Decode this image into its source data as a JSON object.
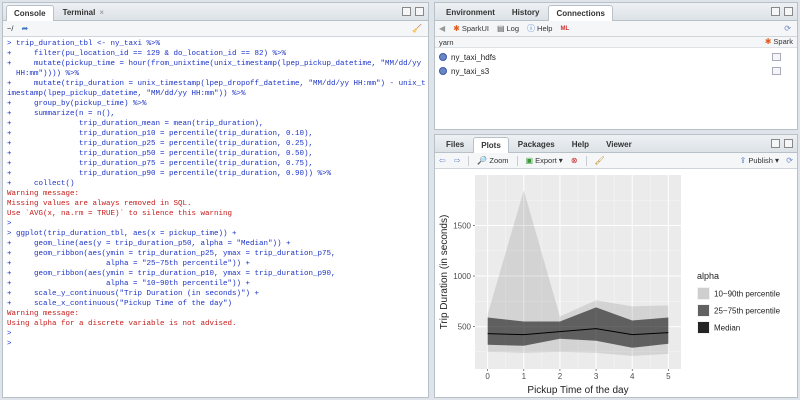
{
  "left_pane": {
    "tabs": [
      {
        "label": "Console",
        "active": true
      },
      {
        "label": "Terminal",
        "active": false
      }
    ],
    "path": "~/",
    "console_lines": [
      {
        "type": "in",
        "text": "> trip_duration_tbl <- ny_taxi %>%"
      },
      {
        "type": "in",
        "text": "+     filter(pu_location_id == 129 & do_location_id == 82) %>%"
      },
      {
        "type": "in",
        "text": "+     mutate(pickup_time = hour(from_unixtime(unix_timestamp(lpep_pickup_datetime, \"MM/dd/yy"
      },
      {
        "type": "in",
        "text": "  HH:mm\")))) %>%"
      },
      {
        "type": "in",
        "text": "+     mutate(trip_duration = unix_timestamp(lpep_dropoff_datetime, \"MM/dd/yy HH:mm\") - unix_t"
      },
      {
        "type": "in",
        "text": "imestamp(lpep_pickup_datetime, \"MM/dd/yy HH:mm\")) %>%"
      },
      {
        "type": "in",
        "text": "+     group_by(pickup_time) %>%"
      },
      {
        "type": "in",
        "text": "+     summarize(n = n(),"
      },
      {
        "type": "in",
        "text": "+               trip_duration_mean = mean(trip_duration),"
      },
      {
        "type": "in",
        "text": "+               trip_duration_p10 = percentile(trip_duration, 0.10),"
      },
      {
        "type": "in",
        "text": "+               trip_duration_p25 = percentile(trip_duration, 0.25),"
      },
      {
        "type": "in",
        "text": "+               trip_duration_p50 = percentile(trip_duration, 0.50),"
      },
      {
        "type": "in",
        "text": "+               trip_duration_p75 = percentile(trip_duration, 0.75),"
      },
      {
        "type": "in",
        "text": "+               trip_duration_p90 = percentile(trip_duration, 0.90)) %>%"
      },
      {
        "type": "in",
        "text": "+     collect()"
      },
      {
        "type": "err",
        "text": "Warning message:"
      },
      {
        "type": "err",
        "text": "Missing values are always removed in SQL."
      },
      {
        "type": "err",
        "text": "Use `AVG(x, na.rm = TRUE)` to silence this warning"
      },
      {
        "type": "in",
        "text": ">"
      },
      {
        "type": "in",
        "text": "> ggplot(trip_duration_tbl, aes(x = pickup_time)) +"
      },
      {
        "type": "in",
        "text": "+     geom_line(aes(y = trip_duration_p50, alpha = \"Median\")) +"
      },
      {
        "type": "in",
        "text": "+     geom_ribbon(aes(ymin = trip_duration_p25, ymax = trip_duration_p75,"
      },
      {
        "type": "in",
        "text": "+                     alpha = \"25~75th percentile\")) +"
      },
      {
        "type": "in",
        "text": "+     geom_ribbon(aes(ymin = trip_duration_p10, ymax = trip_duration_p90,"
      },
      {
        "type": "in",
        "text": "+                     alpha = \"10~90th percentile\")) +"
      },
      {
        "type": "in",
        "text": "+     scale_y_continuous(\"Trip Duration (in seconds)\") +"
      },
      {
        "type": "in",
        "text": "+     scale_x_continuous(\"Pickup Time of the day\")"
      },
      {
        "type": "err",
        "text": "Warning message:"
      },
      {
        "type": "err",
        "text": "Using alpha for a discrete variable is not advised."
      },
      {
        "type": "in",
        "text": ">"
      },
      {
        "type": "in",
        "text": ">"
      }
    ]
  },
  "top_right": {
    "tabs": [
      {
        "label": "Environment",
        "active": false
      },
      {
        "label": "History",
        "active": false
      },
      {
        "label": "Connections",
        "active": true
      }
    ],
    "toolbar": {
      "sparkui": "SparkUI",
      "log": "Log",
      "help": "Help"
    },
    "connection_type": "yarn",
    "spark_label": "Spark",
    "connections": [
      "ny_taxi_hdfs",
      "ny_taxi_s3"
    ]
  },
  "bottom_right": {
    "tabs": [
      {
        "label": "Files",
        "active": false
      },
      {
        "label": "Plots",
        "active": true
      },
      {
        "label": "Packages",
        "active": false
      },
      {
        "label": "Help",
        "active": false
      },
      {
        "label": "Viewer",
        "active": false
      }
    ],
    "toolbar": {
      "zoom": "Zoom",
      "export": "Export",
      "publish": "Publish"
    }
  },
  "chart_data": {
    "type": "area",
    "x": [
      0,
      1,
      2,
      3,
      4,
      5
    ],
    "xlabel": "Pickup Time of the day",
    "ylabel": "Trip Duration (in seconds)",
    "xlim": [
      -0.35,
      5.35
    ],
    "ylim": [
      80,
      2000
    ],
    "x_ticks": [
      0,
      1,
      2,
      3,
      4,
      5
    ],
    "y_ticks": [
      500,
      1000,
      1500
    ],
    "grid": true,
    "legend_title": "alpha",
    "legend_position": "right",
    "series": [
      {
        "name": "10~90th percentile",
        "kind": "ribbon",
        "lower": [
          250,
          240,
          250,
          240,
          210,
          230
        ],
        "upper": [
          620,
          1850,
          600,
          760,
          700,
          710
        ],
        "color": "#000000",
        "alpha": 0.1
      },
      {
        "name": "25~75th percentile",
        "kind": "ribbon",
        "lower": [
          320,
          310,
          380,
          360,
          290,
          330
        ],
        "upper": [
          590,
          550,
          550,
          690,
          560,
          590
        ],
        "color": "#000000",
        "alpha": 0.55
      },
      {
        "name": "Median",
        "kind": "line",
        "values": [
          430,
          420,
          450,
          480,
          420,
          440
        ],
        "color": "#000000"
      }
    ],
    "panel_bg": "#ebebeb"
  }
}
